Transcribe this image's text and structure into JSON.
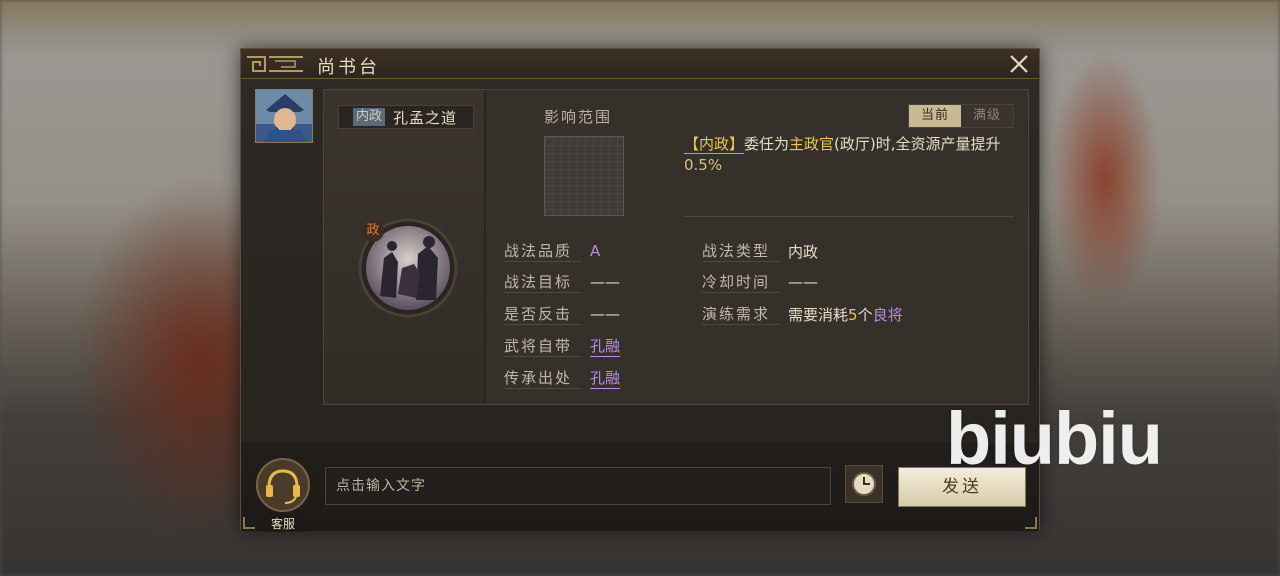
{
  "dialog": {
    "title": "尚书台",
    "skill_tab": {
      "tag": "内政",
      "name": "孔孟之道"
    },
    "skill_icon_badge": "政",
    "range_label": "影响范围",
    "toggle": {
      "current": "当前",
      "max": "满级"
    },
    "description": {
      "tag": "【内政】",
      "part1": "委任为",
      "highlight": "主政官",
      "part2": "(政厅)时,全资源产量提升",
      "percent": "0.5%"
    },
    "attributes_left": [
      {
        "label": "战法品质",
        "value": "A"
      },
      {
        "label": "战法目标",
        "value": "——"
      },
      {
        "label": "是否反击",
        "value": "——"
      },
      {
        "label": "武将自带",
        "value": "孔融"
      },
      {
        "label": "传承出处",
        "value": "孔融"
      }
    ],
    "attributes_right": [
      {
        "label": "战法类型",
        "value": "内政"
      },
      {
        "label": "冷却时间",
        "value": "——"
      },
      {
        "label": "演练需求",
        "value_prefix": "需要消耗",
        "value_num": "5",
        "value_unit": "个",
        "value_rank": "良将"
      }
    ]
  },
  "bottom": {
    "customer_service": "客服",
    "input_placeholder": "点击输入文字",
    "send": "发送"
  },
  "watermark": "biubiu",
  "colors": {
    "accent_gold": "#e8c84a",
    "accent_purple": "#b98ae8",
    "panel": "#35302a"
  },
  "icons": [
    "close-icon",
    "general-avatar",
    "skill-icon",
    "headset-icon",
    "clock-icon"
  ]
}
